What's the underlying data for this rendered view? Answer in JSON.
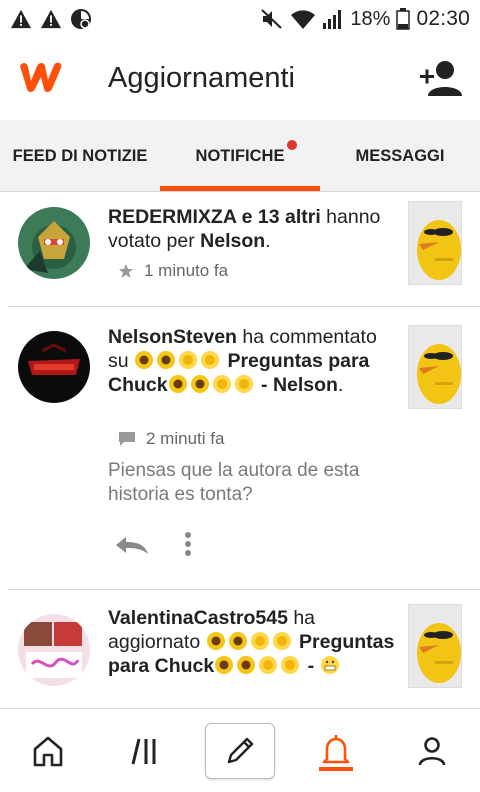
{
  "status_bar": {
    "battery": "18%",
    "time": "02:30",
    "icons": [
      "warning-icon",
      "warning-icon",
      "pinwheel-icon",
      "mute-icon",
      "wifi-icon",
      "signal-icon",
      "battery-icon"
    ]
  },
  "app_bar": {
    "title": "Aggiornamenti",
    "logo": "wattpad-logo",
    "action_icon": "add-user-icon"
  },
  "tabs": [
    {
      "label": "FEED DI NOTIZIE",
      "active": false
    },
    {
      "label": "NOTIFICHE",
      "active": true,
      "badge": true
    },
    {
      "label": "MESSAGGI",
      "active": false
    }
  ],
  "notifications": [
    {
      "user": "REDERMIXZA e 13 altri",
      "verb": " hanno votato per ",
      "target": "Nelson",
      "end": ".",
      "time": "1 minuto fa",
      "type_icon": "star-icon"
    },
    {
      "user": "NelsonSteven",
      "verb": " ha commentato su ",
      "target_pre": "Preguntas para Chuck",
      "target_post": " - Nelson",
      "end": ".",
      "time": "2 minuti fa",
      "type_icon": "comment-icon",
      "comment": "Piensas que la autora de esta historia es tonta?",
      "actions": [
        "reply-icon",
        "more-icon"
      ]
    },
    {
      "user": "ValentinaCastro545",
      "verb": " ha aggiornato ",
      "target_pre": "Preguntas para Chuck",
      "target_post": " - ",
      "end": ""
    }
  ],
  "bottom_nav": [
    "home-icon",
    "library-icon",
    "write-icon",
    "bell-icon",
    "profile-icon"
  ],
  "colors": {
    "accent": "#ff500a",
    "badge": "#e0352b",
    "tab_bg": "#f2f2f2"
  }
}
